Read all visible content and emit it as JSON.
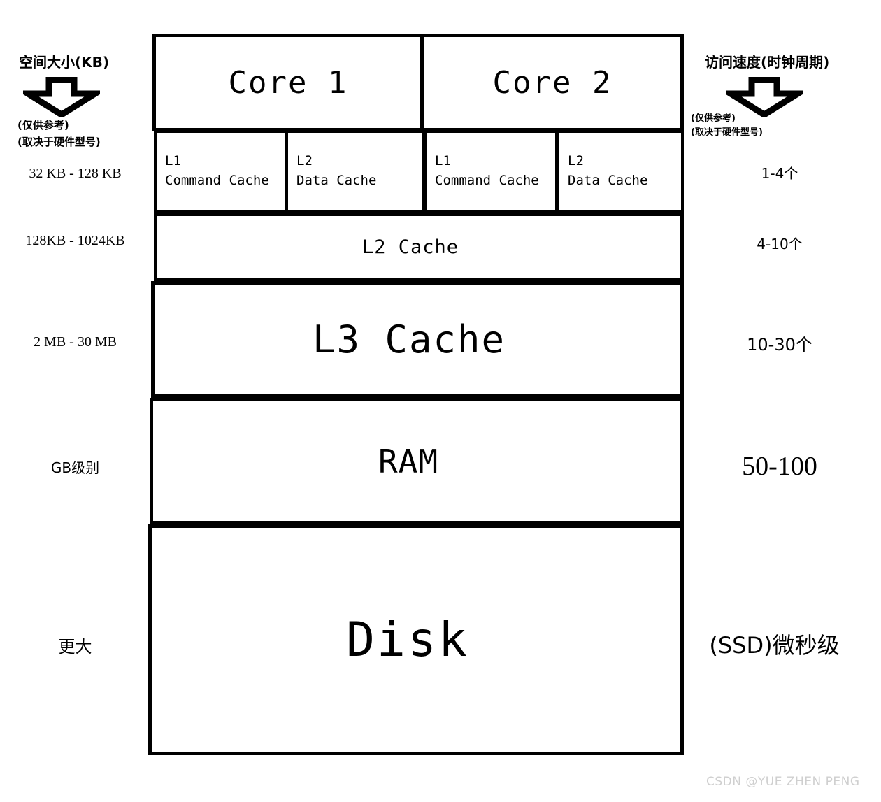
{
  "left_axis": {
    "title": "空间大小(KB)",
    "arrow_icon": "down-arrow-icon",
    "note_line1": "(仅供参考)",
    "note_line2": "(取决于硬件型号)",
    "values": [
      "32 KB - 128 KB",
      "128KB - 1024KB",
      "2 MB - 30 MB",
      "GB级别",
      "更大"
    ]
  },
  "right_axis": {
    "title": "访问速度(时钟周期)",
    "arrow_icon": "down-arrow-icon",
    "note_line1": "(仅供参考)",
    "note_line2": "(取决于硬件型号)",
    "values": [
      "1-4个",
      "4-10个",
      "10-30个",
      "50-100",
      "(SSD)微秒级"
    ]
  },
  "diagram": {
    "cores": [
      {
        "label": "Core 1"
      },
      {
        "label": "Core 2"
      }
    ],
    "core_caches": [
      {
        "level": "L1",
        "name": "Command Cache"
      },
      {
        "level": "L2",
        "name": "Data Cache"
      },
      {
        "level": "L1",
        "name": "Command Cache"
      },
      {
        "level": "L2",
        "name": "Data Cache"
      }
    ],
    "shared_levels": [
      {
        "label": "L2 Cache"
      },
      {
        "label": "L3 Cache"
      },
      {
        "label": "RAM"
      },
      {
        "label": "Disk"
      }
    ]
  },
  "watermark": {
    "text": "CSDN @YUE ZHEN PENG"
  },
  "colors": {
    "stroke": "#000000",
    "background": "#ffffff",
    "watermark": "#cfcfcf"
  }
}
